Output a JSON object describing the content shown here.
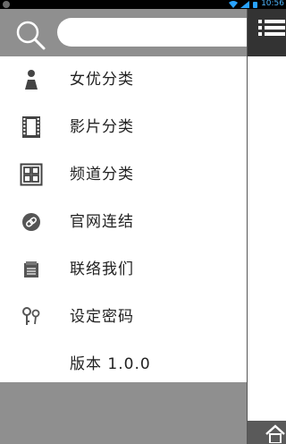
{
  "status_bar": {
    "time": "10:56"
  },
  "search": {
    "placeholder": "",
    "value": ""
  },
  "menu": [
    {
      "label": "女优分类",
      "icon": "person-icon"
    },
    {
      "label": "影片分类",
      "icon": "film-icon"
    },
    {
      "label": "频道分类",
      "icon": "grid-icon"
    },
    {
      "label": "官网连结",
      "icon": "link-icon"
    },
    {
      "label": "联络我们",
      "icon": "contact-icon"
    },
    {
      "label": "设定密码",
      "icon": "key-icon"
    },
    {
      "label": "版本 1.0.0",
      "icon": ""
    }
  ],
  "colors": {
    "drawer_header": "#8f8f8f",
    "appbar": "#333333",
    "text": "#222222",
    "icon": "#444444"
  }
}
